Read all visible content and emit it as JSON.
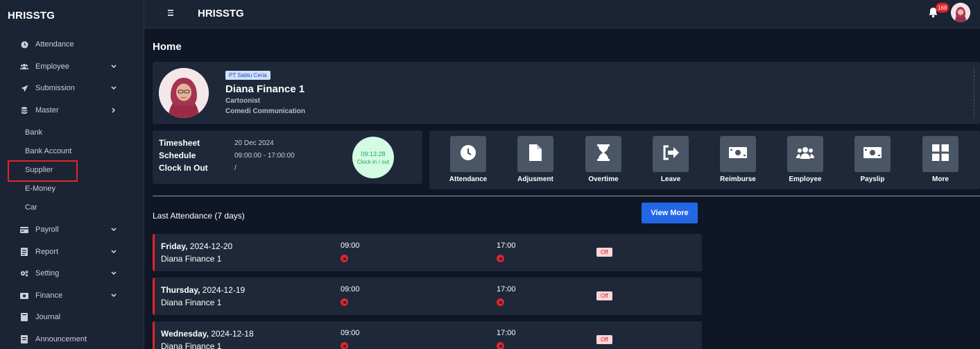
{
  "app": {
    "brand": "HRISSTG",
    "top_title": "HRISSTG",
    "notification_count": "168"
  },
  "sidebar": {
    "items": [
      {
        "label": "Attendance",
        "icon": "clock-icon",
        "chevron": ""
      },
      {
        "label": "Employee",
        "icon": "users-icon",
        "chevron": "down"
      },
      {
        "label": "Submission",
        "icon": "paper-plane-icon",
        "chevron": "down"
      },
      {
        "label": "Master",
        "icon": "database-icon",
        "chevron": "right"
      }
    ],
    "master_sub": [
      "Bank",
      "Bank Account",
      "Supplier",
      "E-Money",
      "Car"
    ],
    "items_after": [
      {
        "label": "Payroll",
        "icon": "card-icon",
        "chevron": "down"
      },
      {
        "label": "Report",
        "icon": "report-icon",
        "chevron": "down"
      },
      {
        "label": "Setting",
        "icon": "gears-icon",
        "chevron": "down"
      },
      {
        "label": "Finance",
        "icon": "money-icon",
        "chevron": "down"
      },
      {
        "label": "Journal",
        "icon": "book-icon",
        "chevron": ""
      },
      {
        "label": "Announcement",
        "icon": "announcement-icon",
        "chevron": ""
      }
    ]
  },
  "page": {
    "title": "Home"
  },
  "profile": {
    "company": "PT Sabtu Ceria",
    "name": "Diana Finance 1",
    "role": "Cartoonist",
    "org": "Comedi Communication"
  },
  "timesheet": {
    "labels": [
      "Timesheet",
      "Schedule",
      "Clock In Out"
    ],
    "values": [
      "20 Dec 2024",
      "09:00:00 - 17:00:00",
      "/"
    ],
    "clock_time": "09:13:28",
    "clock_label": "Clock in / out"
  },
  "quick_actions": [
    {
      "label": "Attendance",
      "icon": "clock-icon"
    },
    {
      "label": "Adjusment",
      "icon": "file-icon"
    },
    {
      "label": "Overtime",
      "icon": "hourglass-icon"
    },
    {
      "label": "Leave",
      "icon": "sign-out-icon"
    },
    {
      "label": "Reimburse",
      "icon": "money-bill-icon"
    },
    {
      "label": "Employee",
      "icon": "users-icon"
    },
    {
      "label": "Payslip",
      "icon": "money-bill-icon"
    },
    {
      "label": "More",
      "icon": "grid-icon"
    }
  ],
  "last_attendance": {
    "title": "Last Attendance (7 days)",
    "view_more": "View More",
    "rows": [
      {
        "day": "Friday,",
        "date": " 2024-12-20",
        "name": "Diana Finance 1",
        "in": "09:00",
        "out": "17:00",
        "status": "Off"
      },
      {
        "day": "Thursday,",
        "date": " 2024-12-19",
        "name": "Diana Finance 1",
        "in": "09:00",
        "out": "17:00",
        "status": "Off"
      },
      {
        "day": "Wednesday,",
        "date": " 2024-12-18",
        "name": "Diana Finance 1",
        "in": "09:00",
        "out": "17:00",
        "status": "Off"
      }
    ]
  },
  "colors": {
    "accent": "#2467e6",
    "danger": "#e3232b",
    "success_bg": "#d4fbe4"
  }
}
